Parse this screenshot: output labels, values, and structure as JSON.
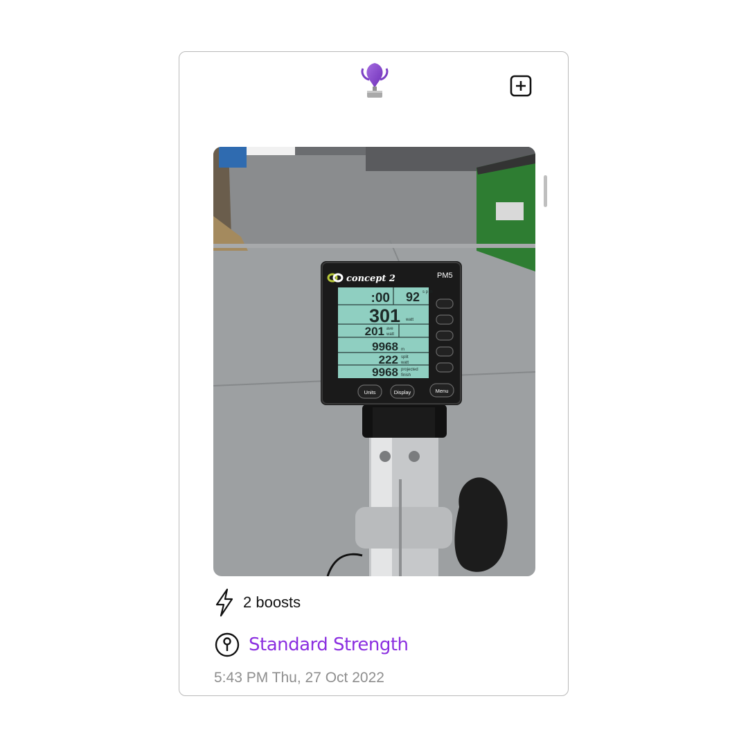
{
  "header": {
    "logo_icon": "trophy-logo-icon",
    "add_icon": "plus-square-icon"
  },
  "post": {
    "photo_alt": "Concept2 rower monitor photo",
    "monitor": {
      "brand": "concept 2",
      "model": "PM5",
      "time": ":00",
      "spm": "92",
      "spm_unit": "s p m",
      "watts": "301",
      "watts_unit": "watt",
      "ave_watts": "201",
      "ave_unit_1": "ave",
      "ave_unit_2": "watt",
      "meters": "9968",
      "meters_unit": "m",
      "split": "222",
      "split_unit_1": "split",
      "split_unit_2": "watt",
      "projected": "9968",
      "projected_unit_1": "projected",
      "projected_unit_2": "finish",
      "buttons": [
        "Units",
        "Display",
        "Menu"
      ]
    },
    "boosts_icon": "lightning-bolt-icon",
    "boosts_text": "2 boosts",
    "goal_icon": "pin-icon",
    "goal_text": "Standard Strength",
    "timestamp": "5:43 PM Thu, 27 Oct 2022"
  },
  "colors": {
    "accent": "#8b2fe0",
    "timestamp": "#8e8e8e"
  }
}
